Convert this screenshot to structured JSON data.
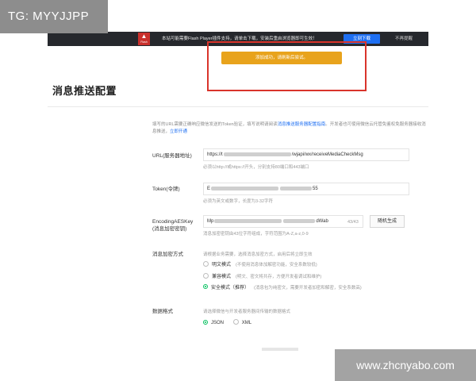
{
  "watermarks": {
    "top_left": "TG: MYYJJPP",
    "bottom_right": "www.zhcnyabo.com"
  },
  "flash_bar": {
    "icon_label": "Flash",
    "message": "本站可能需要Flash Player插件支持，请单击下载，安装后重启浏览器即可生效！",
    "download_button": "立刻下载",
    "dismiss": "不再提醒"
  },
  "toast": {
    "message": "添加成功，请刷新后尝试。"
  },
  "page_title": "消息推送配置",
  "intro": {
    "text": "填写的URL需要正确响应微信发送的Token验证，填写说明请阅读",
    "link1": "消息推送服务器配置指南",
    "text2": "。开发者也可使用微信云托管免鉴权免服务器接收消息推送，",
    "link2": "立即开通"
  },
  "form": {
    "url": {
      "label": "URL(服务器地址)",
      "value_prefix": "https://t",
      "value_suffix": "/wjapi/wx/receiveMediaCheckMsg",
      "hint": "必须以http://或https://开头，分别支持80端口和443端口"
    },
    "token": {
      "label": "Token(令牌)",
      "value_prefix": "E",
      "value_suffix": "55",
      "hint": "必须为英文或数字，长度为3-32字符"
    },
    "aes": {
      "label": "EncodingAESKey",
      "label2": "(消息加密密钥)",
      "value_prefix": "Mp",
      "value_suffix": "dWab",
      "counter": "43/43",
      "generate_button": "随机生成",
      "hint": "消息加密密钥由43位字符组成，字符范围为A-Z,a-z,0-9"
    },
    "encryption": {
      "label": "消息加密方式",
      "hint": "请根据业务需要，选择消息加密方式，启用后将立即生效",
      "options": [
        {
          "label": "明文模式",
          "desc": "(不使用消息体加解密功能，安全系数较低)",
          "selected": false
        },
        {
          "label": "兼容模式",
          "desc": "(明文、密文将共存，方便开发者调试和维护)",
          "selected": false
        },
        {
          "label": "安全模式（推荐）",
          "desc": "(消息包为纯密文，需要开发者加密和解密，安全系数高)",
          "selected": true
        }
      ]
    },
    "format": {
      "label": "数据格式",
      "hint": "请选择微信与开发者服务器间传输的数据格式",
      "options": [
        {
          "label": "JSON",
          "selected": true
        },
        {
          "label": "XML",
          "selected": false
        }
      ]
    }
  },
  "colors": {
    "accent_green": "#07c160",
    "link_blue": "#1e6ff2",
    "toast_orange": "#e8a31c",
    "highlight_red": "#d9342b",
    "bar_dark": "#26282d"
  }
}
